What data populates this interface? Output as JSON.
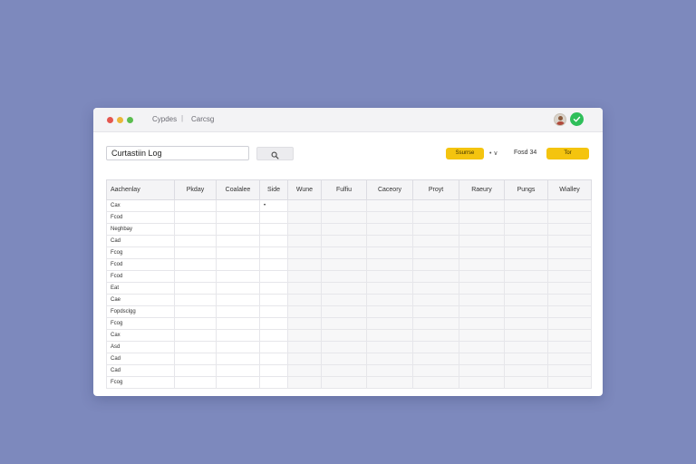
{
  "window": {
    "tabs": [
      "Cypdes",
      "Carcsg"
    ],
    "separator": "|",
    "status_icon": "check-icon"
  },
  "toolbar": {
    "log_title": "Curtastiin Log",
    "search_icon": "search-icon",
    "primary_button": "Ssurrse",
    "sort_toggle": "• ∨",
    "page_label": "Fosd 34",
    "secondary_button": "Tor"
  },
  "table": {
    "columns": [
      "Aachenlay",
      "Pkday",
      "Coalalee",
      "Side",
      "Wune",
      "Fulfiu",
      "Caceory",
      "Proyt",
      "Raeury",
      "Pungs",
      "Wialley"
    ],
    "rows": [
      [
        "Cax",
        "",
        "",
        "•",
        "",
        "",
        "",
        "",
        "",
        "",
        ""
      ],
      [
        "Fcod",
        "",
        "",
        "",
        "",
        "",
        "",
        "",
        "",
        "",
        ""
      ],
      [
        "Neghbay",
        "",
        "",
        "",
        "",
        "",
        "",
        "",
        "",
        "",
        ""
      ],
      [
        "Cad",
        "",
        "",
        "",
        "",
        "",
        "",
        "",
        "",
        "",
        ""
      ],
      [
        "Fcog",
        "",
        "",
        "",
        "",
        "",
        "",
        "",
        "",
        "",
        ""
      ],
      [
        "Fcod",
        "",
        "",
        "",
        "",
        "",
        "",
        "",
        "",
        "",
        ""
      ],
      [
        "Fcod",
        "",
        "",
        "",
        "",
        "",
        "",
        "",
        "",
        "",
        ""
      ],
      [
        "Eat",
        "",
        "",
        "",
        "",
        "",
        "",
        "",
        "",
        "",
        ""
      ],
      [
        "Cae",
        "",
        "",
        "",
        "",
        "",
        "",
        "",
        "",
        "",
        ""
      ],
      [
        "Fopdsclgg",
        "",
        "",
        "",
        "",
        "",
        "",
        "",
        "",
        "",
        ""
      ],
      [
        "Fcog",
        "",
        "",
        "",
        "",
        "",
        "",
        "",
        "",
        "",
        ""
      ],
      [
        "Cax",
        "",
        "",
        "",
        "",
        "",
        "",
        "",
        "",
        "",
        ""
      ],
      [
        "Asd",
        "",
        "",
        "",
        "",
        "",
        "",
        "",
        "",
        "",
        ""
      ],
      [
        "Cad",
        "",
        "",
        "",
        "",
        "",
        "",
        "",
        "",
        "",
        ""
      ],
      [
        "Cad",
        "",
        "",
        "",
        "",
        "",
        "",
        "",
        "",
        "",
        ""
      ],
      [
        "Fcog",
        "",
        "",
        "",
        "",
        "",
        "",
        "",
        "",
        "",
        ""
      ]
    ]
  },
  "colors": {
    "background": "#7d89bd",
    "accent": "#f4c40f",
    "status": "#2fbf5a"
  }
}
